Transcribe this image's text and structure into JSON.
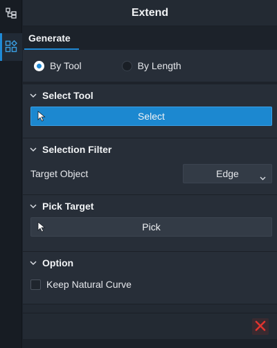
{
  "panel": {
    "title": "Extend"
  },
  "rail": {
    "icons": [
      "tree-structure-icon",
      "widget-grid-icon"
    ],
    "accent": "#1f8ad6"
  },
  "tabs": [
    {
      "label": "Generate",
      "active": true
    }
  ],
  "mode": {
    "options": [
      {
        "label": "By Tool",
        "selected": true
      },
      {
        "label": "By Length",
        "selected": false
      }
    ]
  },
  "sections": {
    "select_tool": {
      "title": "Select Tool",
      "button_label": "Select",
      "button_icon": "pointer-icon"
    },
    "selection_filter": {
      "title": "Selection Filter",
      "target_label": "Target Object",
      "target_value": "Edge"
    },
    "pick_target": {
      "title": "Pick Target",
      "button_label": "Pick",
      "button_icon": "pointer-icon"
    },
    "option": {
      "title": "Option",
      "checkbox_label": "Keep Natural Curve",
      "checkbox_checked": false
    }
  },
  "footer": {
    "close_icon": "close-x-icon",
    "close_color": "#e0342f"
  }
}
